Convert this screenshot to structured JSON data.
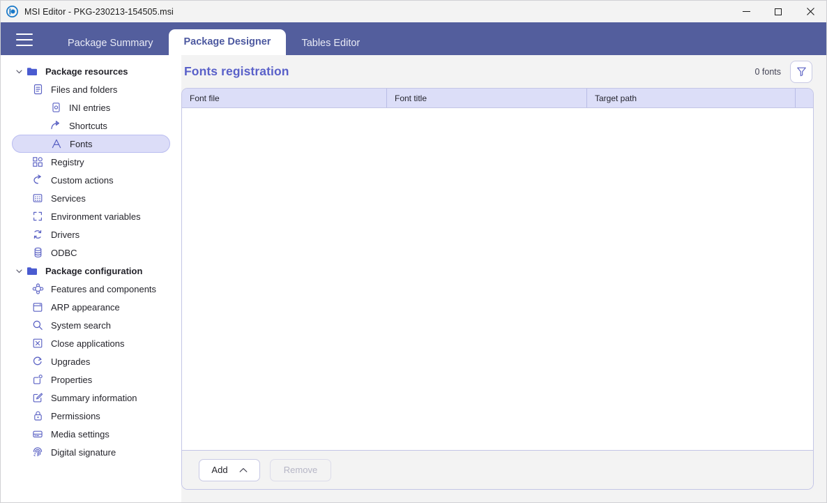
{
  "window": {
    "title": "MSI Editor - PKG-230213-154505.msi",
    "app_icon": "msi-editor-logo",
    "controls": {
      "minimize": "minimize-icon",
      "maximize": "maximize-icon",
      "close": "close-icon"
    }
  },
  "navband": {
    "menu_icon": "hamburger-menu-icon",
    "tabs": [
      {
        "label": "Package Summary",
        "active": false
      },
      {
        "label": "Package Designer",
        "active": true
      },
      {
        "label": "Tables Editor",
        "active": false
      }
    ]
  },
  "sidebar": {
    "items": [
      {
        "label": "Package resources",
        "icon": "folder-icon",
        "level": 1,
        "group": true,
        "expanded": true,
        "selected": false
      },
      {
        "label": "Files and folders",
        "icon": "document-icon",
        "level": 2,
        "group": false,
        "selected": false
      },
      {
        "label": "INI entries",
        "icon": "ini-file-icon",
        "level": 3,
        "group": false,
        "selected": false
      },
      {
        "label": "Shortcuts",
        "icon": "shortcut-arrow-icon",
        "level": 3,
        "group": false,
        "selected": false
      },
      {
        "label": "Fonts",
        "icon": "font-letter-a-icon",
        "level": 3,
        "group": false,
        "selected": true
      },
      {
        "label": "Registry",
        "icon": "registry-blocks-icon",
        "level": 2,
        "group": false,
        "selected": false
      },
      {
        "label": "Custom actions",
        "icon": "custom-action-arrow-icon",
        "level": 2,
        "group": false,
        "selected": false
      },
      {
        "label": "Services",
        "icon": "services-grid-icon",
        "level": 2,
        "group": false,
        "selected": false
      },
      {
        "label": "Environment variables",
        "icon": "environment-brackets-icon",
        "level": 2,
        "group": false,
        "selected": false
      },
      {
        "label": "Drivers",
        "icon": "drivers-refresh-icon",
        "level": 2,
        "group": false,
        "selected": false
      },
      {
        "label": "ODBC",
        "icon": "database-icon",
        "level": 2,
        "group": false,
        "selected": false
      },
      {
        "label": "Package configuration",
        "icon": "folder-icon",
        "level": 1,
        "group": true,
        "expanded": true,
        "selected": false
      },
      {
        "label": "Features and components",
        "icon": "features-nodes-icon",
        "level": 2,
        "group": false,
        "selected": false
      },
      {
        "label": "ARP appearance",
        "icon": "window-icon",
        "level": 2,
        "group": false,
        "selected": false
      },
      {
        "label": "System search",
        "icon": "search-icon",
        "level": 2,
        "group": false,
        "selected": false
      },
      {
        "label": "Close applications",
        "icon": "close-box-icon",
        "level": 2,
        "group": false,
        "selected": false
      },
      {
        "label": "Upgrades",
        "icon": "upgrade-circle-icon",
        "level": 2,
        "group": false,
        "selected": false
      },
      {
        "label": "Properties",
        "icon": "properties-icon",
        "level": 2,
        "group": false,
        "selected": false
      },
      {
        "label": "Summary information",
        "icon": "edit-pencil-icon",
        "level": 2,
        "group": false,
        "selected": false
      },
      {
        "label": "Permissions",
        "icon": "lock-icon",
        "level": 2,
        "group": false,
        "selected": false
      },
      {
        "label": "Media settings",
        "icon": "media-disk-icon",
        "level": 2,
        "group": false,
        "selected": false
      },
      {
        "label": "Digital signature",
        "icon": "fingerprint-icon",
        "level": 2,
        "group": false,
        "selected": false
      }
    ]
  },
  "main": {
    "title": "Fonts registration",
    "count_label": "0 fonts",
    "filter_icon": "filter-funnel-icon",
    "grid": {
      "columns": [
        "Font file",
        "Font title",
        "Target path"
      ],
      "rows": []
    },
    "footer": {
      "add_label": "Add",
      "add_caret_icon": "chevron-up-icon",
      "remove_label": "Remove",
      "remove_disabled": true
    }
  },
  "colors": {
    "brand_band": "#535e9d",
    "accent_title": "#5a61c9",
    "grid_header": "#dcdef8",
    "selected_item": "#dcddf8",
    "icon": "#5b62c4"
  }
}
